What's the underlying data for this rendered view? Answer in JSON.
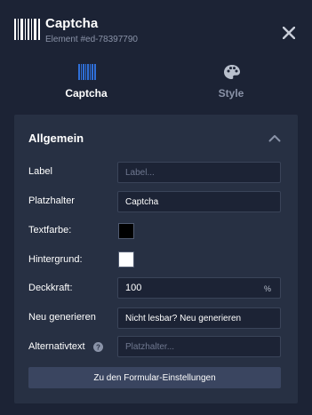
{
  "header": {
    "title": "Captcha",
    "element_id": "Element #ed-78397790"
  },
  "tabs": [
    {
      "label": "Captcha",
      "icon": "barcode-icon",
      "active": true
    },
    {
      "label": "Style",
      "icon": "palette-icon",
      "active": false
    }
  ],
  "section": {
    "title": "Allgemein",
    "fields": {
      "label": {
        "label": "Label",
        "value": "",
        "placeholder": "Label..."
      },
      "placeholder": {
        "label": "Platzhalter",
        "value": "Captcha",
        "placeholder": ""
      },
      "text_color": {
        "label": "Textfarbe:",
        "color": "#000000"
      },
      "background": {
        "label": "Hintergrund:",
        "color": "#ffffff"
      },
      "opacity": {
        "label": "Deckkraft:",
        "value": "100",
        "unit": "%"
      },
      "regenerate": {
        "label": "Neu generieren",
        "value": "Nicht lesbar? Neu generieren"
      },
      "alt_text": {
        "label": "Alternativtext",
        "value": "",
        "placeholder": "Platzhalter..."
      }
    },
    "button_label": "Zu den Formular-Einstellungen"
  },
  "colors": {
    "background": "#1c2335",
    "panel": "#273043",
    "accent": "#2f6fd8"
  }
}
